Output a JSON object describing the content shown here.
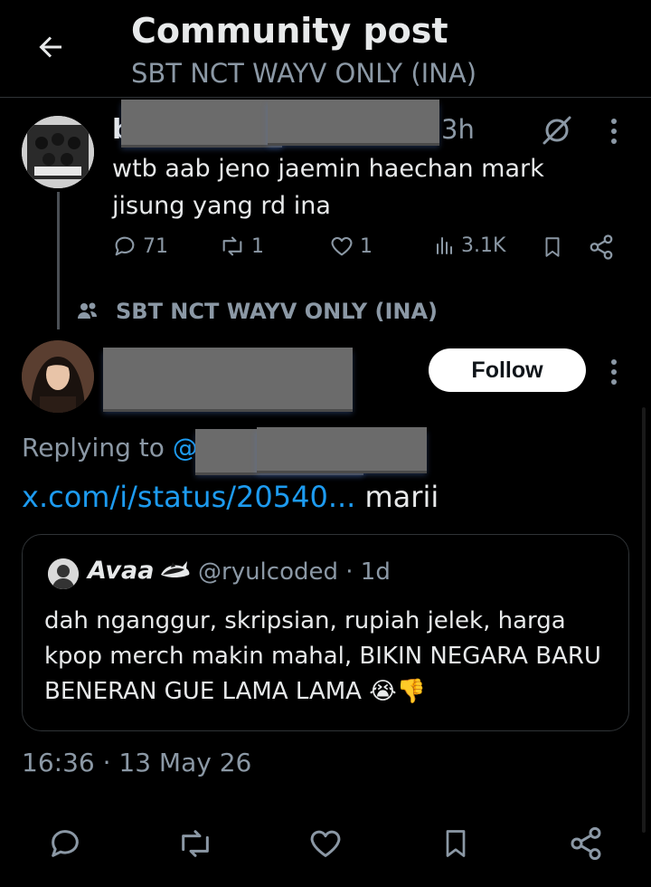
{
  "header": {
    "title": "Community post",
    "subtitle": "SBT NCT WAYV ONLY (INA)"
  },
  "parent_tweet": {
    "name_initial": "b",
    "time": "3h",
    "text": "wtb aab jeno jaemin haechan mark jisung yang rd ina",
    "replies": "71",
    "reposts": "1",
    "likes": "1",
    "views": "3.1K"
  },
  "community": {
    "label": "SBT NCT WAYV ONLY (INA)"
  },
  "main_tweet": {
    "follow_label": "Follow",
    "replying_prefix": "Replying to ",
    "replying_handle": "@",
    "link_text": "x.com/i/status/20540...",
    "text_after_link": " marii",
    "timestamp": "16:36 · 13 May 26"
  },
  "quoted_tweet": {
    "name": "Avaa",
    "handle_time": "@ryulcoded · 1d",
    "text": "dah nganggur, skripsian, rupiah jelek, harga kpop merch makin mahal, BIKIN NEGARA BARU BENERAN GUE LAMA LAMA 😭👎"
  },
  "colors": {
    "background": "#000000",
    "text": "#e7e9ea",
    "muted": "#8b98a5",
    "link": "#1d9bf0",
    "border": "#2f3336"
  }
}
